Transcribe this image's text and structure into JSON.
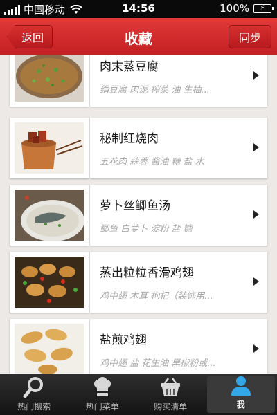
{
  "status_bar": {
    "carrier": "中国移动",
    "time": "14:56",
    "battery": "100%"
  },
  "nav": {
    "title": "收藏",
    "back_label": "返回",
    "sync_label": "同步"
  },
  "recipes": [
    {
      "name": "肉末蒸豆腐",
      "ingredients": "绢豆腐 肉泥 榨菜 油 生抽..."
    },
    {
      "name": "秘制红烧肉",
      "ingredients": "五花肉 蒜蓉 酱油 糖 盐 水"
    },
    {
      "name": "萝卜丝鲫鱼汤",
      "ingredients": "鲫鱼 白萝卜 淀粉 盐 糖"
    },
    {
      "name": "蒸出粒粒香滑鸡翅",
      "ingredients": "鸡中翅 木耳 枸杞（装饰用..."
    },
    {
      "name": "盐煎鸡翅",
      "ingredients": "鸡中翅 盐 花生油 黑椒粉或..."
    }
  ],
  "tabs": [
    {
      "label": "热门搜索",
      "icon": "magnifier-icon"
    },
    {
      "label": "热门菜单",
      "icon": "chef-hat-icon"
    },
    {
      "label": "购买清单",
      "icon": "basket-icon"
    },
    {
      "label": "我",
      "icon": "user-icon"
    }
  ],
  "colors": {
    "nav_red": "#d02a2c",
    "tab_bar": "#1e1e1e",
    "background": "#ece9e6",
    "active_tab_icon": "#33a8e8"
  }
}
